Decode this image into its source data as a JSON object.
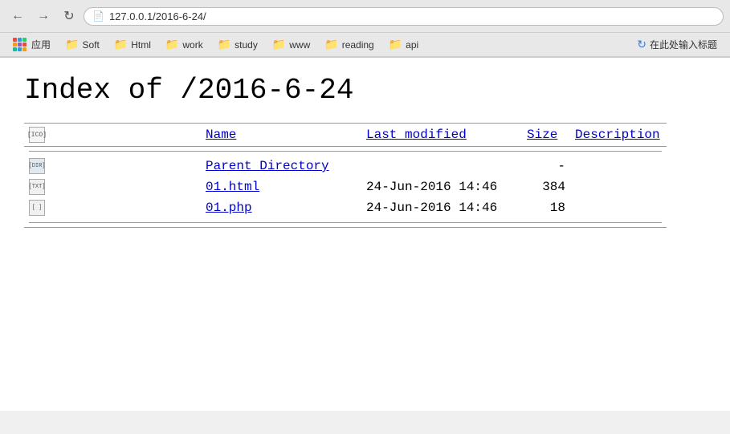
{
  "browser": {
    "back_title": "Back",
    "forward_title": "Forward",
    "reload_title": "Reload",
    "address": "127.0.0.1/2016-6-24/",
    "address_display": "127.0.0.1/2016-6-24/"
  },
  "bookmarks": [
    {
      "id": "apps",
      "label": "应用",
      "type": "apps"
    },
    {
      "id": "soft",
      "label": "Soft",
      "type": "folder"
    },
    {
      "id": "html",
      "label": "Html",
      "type": "folder"
    },
    {
      "id": "work",
      "label": "work",
      "type": "folder"
    },
    {
      "id": "study",
      "label": "study",
      "type": "folder"
    },
    {
      "id": "www",
      "label": "www",
      "type": "folder"
    },
    {
      "id": "reading",
      "label": "reading",
      "type": "folder"
    },
    {
      "id": "api",
      "label": "api",
      "type": "folder"
    }
  ],
  "bookmark_special": {
    "label": "在此处输入标题",
    "icon": "🔄"
  },
  "page": {
    "title": "Index of /2016-6-24",
    "columns": {
      "icon": "[ICO]",
      "name": "Name",
      "modified": "Last modified",
      "size": "Size",
      "description": "Description"
    },
    "entries": [
      {
        "type": "dir",
        "icon_label": "[DIR]",
        "name": "Parent Directory",
        "modified": "",
        "size": "-",
        "description": ""
      },
      {
        "type": "txt",
        "icon_label": "[TXT]",
        "name": "01.html",
        "modified": "24-Jun-2016 14:46",
        "size": "384",
        "description": ""
      },
      {
        "type": "unknown",
        "icon_label": "[ ]",
        "name": "01.php",
        "modified": "24-Jun-2016 14:46",
        "size": "18",
        "description": ""
      }
    ]
  }
}
